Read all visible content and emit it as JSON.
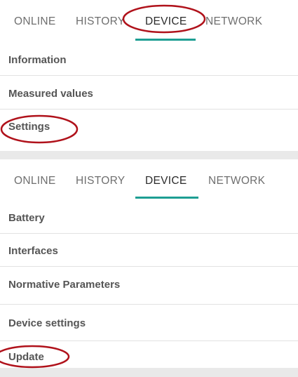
{
  "top_screen": {
    "tabs": [
      {
        "label": "ONLINE",
        "active": false
      },
      {
        "label": "HISTORY",
        "active": false
      },
      {
        "label": "DEVICE",
        "active": true
      },
      {
        "label": "NETWORK",
        "active": false
      }
    ],
    "items": [
      {
        "label": "Information"
      },
      {
        "label": "Measured values"
      },
      {
        "label": "Settings"
      }
    ]
  },
  "bottom_screen": {
    "tabs": [
      {
        "label": "ONLINE",
        "active": false
      },
      {
        "label": "HISTORY",
        "active": false
      },
      {
        "label": "DEVICE",
        "active": true
      },
      {
        "label": "NETWORK",
        "active": false
      }
    ],
    "items": [
      {
        "label": "Battery"
      },
      {
        "label": "Interfaces"
      },
      {
        "label": "Normative Parameters"
      },
      {
        "label": "Device settings"
      },
      {
        "label": "Update"
      }
    ]
  },
  "colors": {
    "tab_indicator": "#1e9e93",
    "annotation_circle": "#b0121b",
    "inactive_tab_text": "#6f6f6f",
    "item_text": "#555555"
  }
}
